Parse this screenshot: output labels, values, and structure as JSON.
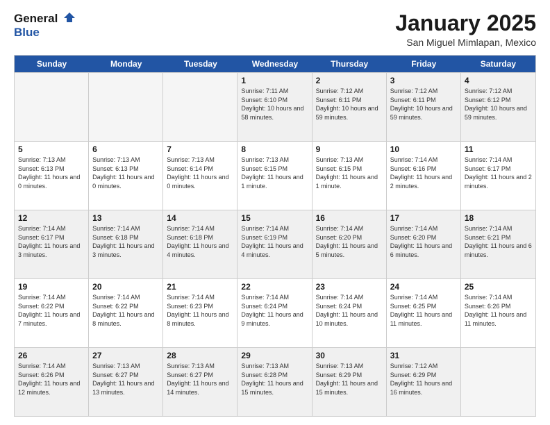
{
  "header": {
    "logo_line1": "General",
    "logo_line2": "Blue",
    "month_title": "January 2025",
    "location": "San Miguel Mimlapan, Mexico"
  },
  "weekdays": [
    "Sunday",
    "Monday",
    "Tuesday",
    "Wednesday",
    "Thursday",
    "Friday",
    "Saturday"
  ],
  "weeks": [
    [
      {
        "day": "",
        "empty": true
      },
      {
        "day": "",
        "empty": true
      },
      {
        "day": "",
        "empty": true
      },
      {
        "day": "1",
        "sunrise": "7:11 AM",
        "sunset": "6:10 PM",
        "daylight": "10 hours and 58 minutes."
      },
      {
        "day": "2",
        "sunrise": "7:12 AM",
        "sunset": "6:11 PM",
        "daylight": "10 hours and 59 minutes."
      },
      {
        "day": "3",
        "sunrise": "7:12 AM",
        "sunset": "6:11 PM",
        "daylight": "10 hours and 59 minutes."
      },
      {
        "day": "4",
        "sunrise": "7:12 AM",
        "sunset": "6:12 PM",
        "daylight": "10 hours and 59 minutes."
      }
    ],
    [
      {
        "day": "5",
        "sunrise": "7:13 AM",
        "sunset": "6:13 PM",
        "daylight": "11 hours and 0 minutes."
      },
      {
        "day": "6",
        "sunrise": "7:13 AM",
        "sunset": "6:13 PM",
        "daylight": "11 hours and 0 minutes."
      },
      {
        "day": "7",
        "sunrise": "7:13 AM",
        "sunset": "6:14 PM",
        "daylight": "11 hours and 0 minutes."
      },
      {
        "day": "8",
        "sunrise": "7:13 AM",
        "sunset": "6:15 PM",
        "daylight": "11 hours and 1 minute."
      },
      {
        "day": "9",
        "sunrise": "7:13 AM",
        "sunset": "6:15 PM",
        "daylight": "11 hours and 1 minute."
      },
      {
        "day": "10",
        "sunrise": "7:14 AM",
        "sunset": "6:16 PM",
        "daylight": "11 hours and 2 minutes."
      },
      {
        "day": "11",
        "sunrise": "7:14 AM",
        "sunset": "6:17 PM",
        "daylight": "11 hours and 2 minutes."
      }
    ],
    [
      {
        "day": "12",
        "sunrise": "7:14 AM",
        "sunset": "6:17 PM",
        "daylight": "11 hours and 3 minutes."
      },
      {
        "day": "13",
        "sunrise": "7:14 AM",
        "sunset": "6:18 PM",
        "daylight": "11 hours and 3 minutes."
      },
      {
        "day": "14",
        "sunrise": "7:14 AM",
        "sunset": "6:18 PM",
        "daylight": "11 hours and 4 minutes."
      },
      {
        "day": "15",
        "sunrise": "7:14 AM",
        "sunset": "6:19 PM",
        "daylight": "11 hours and 4 minutes."
      },
      {
        "day": "16",
        "sunrise": "7:14 AM",
        "sunset": "6:20 PM",
        "daylight": "11 hours and 5 minutes."
      },
      {
        "day": "17",
        "sunrise": "7:14 AM",
        "sunset": "6:20 PM",
        "daylight": "11 hours and 6 minutes."
      },
      {
        "day": "18",
        "sunrise": "7:14 AM",
        "sunset": "6:21 PM",
        "daylight": "11 hours and 6 minutes."
      }
    ],
    [
      {
        "day": "19",
        "sunrise": "7:14 AM",
        "sunset": "6:22 PM",
        "daylight": "11 hours and 7 minutes."
      },
      {
        "day": "20",
        "sunrise": "7:14 AM",
        "sunset": "6:22 PM",
        "daylight": "11 hours and 8 minutes."
      },
      {
        "day": "21",
        "sunrise": "7:14 AM",
        "sunset": "6:23 PM",
        "daylight": "11 hours and 8 minutes."
      },
      {
        "day": "22",
        "sunrise": "7:14 AM",
        "sunset": "6:24 PM",
        "daylight": "11 hours and 9 minutes."
      },
      {
        "day": "23",
        "sunrise": "7:14 AM",
        "sunset": "6:24 PM",
        "daylight": "11 hours and 10 minutes."
      },
      {
        "day": "24",
        "sunrise": "7:14 AM",
        "sunset": "6:25 PM",
        "daylight": "11 hours and 11 minutes."
      },
      {
        "day": "25",
        "sunrise": "7:14 AM",
        "sunset": "6:26 PM",
        "daylight": "11 hours and 11 minutes."
      }
    ],
    [
      {
        "day": "26",
        "sunrise": "7:14 AM",
        "sunset": "6:26 PM",
        "daylight": "11 hours and 12 minutes."
      },
      {
        "day": "27",
        "sunrise": "7:13 AM",
        "sunset": "6:27 PM",
        "daylight": "11 hours and 13 minutes."
      },
      {
        "day": "28",
        "sunrise": "7:13 AM",
        "sunset": "6:27 PM",
        "daylight": "11 hours and 14 minutes."
      },
      {
        "day": "29",
        "sunrise": "7:13 AM",
        "sunset": "6:28 PM",
        "daylight": "11 hours and 15 minutes."
      },
      {
        "day": "30",
        "sunrise": "7:13 AM",
        "sunset": "6:29 PM",
        "daylight": "11 hours and 15 minutes."
      },
      {
        "day": "31",
        "sunrise": "7:12 AM",
        "sunset": "6:29 PM",
        "daylight": "11 hours and 16 minutes."
      },
      {
        "day": "",
        "empty": true
      }
    ]
  ],
  "labels": {
    "sunrise": "Sunrise:",
    "sunset": "Sunset:",
    "daylight": "Daylight:"
  }
}
